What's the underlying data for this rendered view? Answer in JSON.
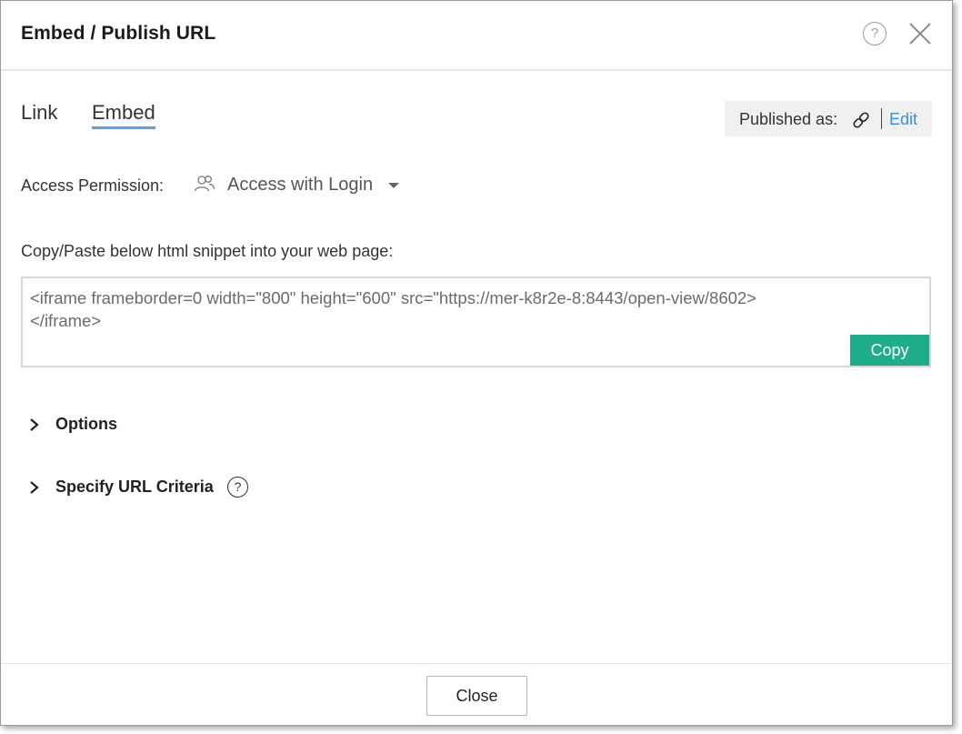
{
  "dialog": {
    "title": "Embed / Publish URL",
    "help_icon": "question-circle-icon",
    "close_icon": "close-icon"
  },
  "tabs": [
    {
      "label": "Link",
      "active": false
    },
    {
      "label": "Embed",
      "active": true
    }
  ],
  "published": {
    "label": "Published as:",
    "icon": "link-icon",
    "edit_label": "Edit"
  },
  "permission": {
    "label": "Access Permission:",
    "icon": "users-icon",
    "value": "Access with Login"
  },
  "snippet": {
    "label": "Copy/Paste below html snippet into your web page:",
    "code": "<iframe frameborder=0 width=\"800\" height=\"600\" src=\"https://mer-k8r2e-8:8443/open-view/8602>\n</iframe>",
    "copy_label": "Copy"
  },
  "sections": [
    {
      "label": "Options",
      "has_help": false
    },
    {
      "label": "Specify URL Criteria",
      "has_help": true
    }
  ],
  "footer": {
    "close_label": "Close"
  },
  "colors": {
    "accent": "#3b8de0",
    "copy_button": "#1fae8a",
    "tab_underline": "#5a9ee8"
  }
}
